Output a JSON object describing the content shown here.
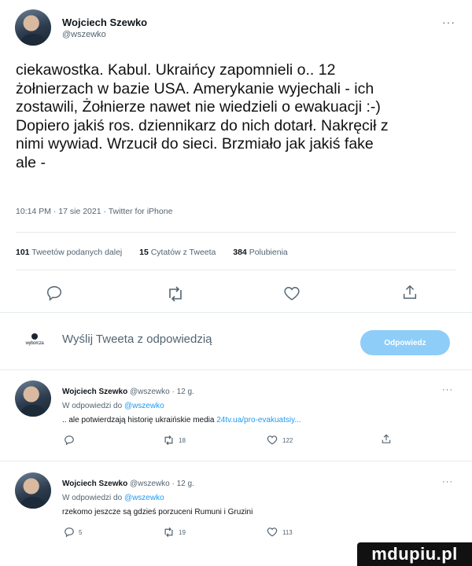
{
  "main_tweet": {
    "author_name": "Wojciech Szewko",
    "author_handle": "@wszewko",
    "more": "···",
    "text": "ciekawostka. Kabul. Ukraińcy zapomnieli o.. 12\nżołnierzach w bazie USA. Amerykanie wyjechali - ich\nzostawili, Żołnierze nawet nie wiedzieli o ewakuacji :-)\nDopiero jakiś ros. dziennikarz do nich dotarł. Nakręcił z\nnimi wywiad. Wrzucił do sieci. Brzmiało jak jakiś fake\nale -",
    "meta": "10:14 PM · 17 sie 2021 · Twitter for iPhone",
    "stats": {
      "retweets_count": "101",
      "retweets_label": "Tweetów podanych dalej",
      "quotes_count": "15",
      "quotes_label": "Cytatów z Tweeta",
      "likes_count": "384",
      "likes_label": "Polubienia"
    },
    "action_icons": [
      "reply-icon",
      "retweet-icon",
      "like-icon",
      "share-icon"
    ]
  },
  "reply_bar": {
    "avatar_label": "wyborcza",
    "placeholder": "Wyślij Tweeta z odpowiedzią",
    "button_label": "Odpowiedz"
  },
  "replies": [
    {
      "author_name": "Wojciech Szewko",
      "handle_time": "@wszewko · 12 g.",
      "more": "···",
      "replying_prefix": "W odpowiedzi do",
      "replying_handle": "@wszewko",
      "text": ".. ale potwierdzają historię ukraińskie media",
      "link": "24tv.ua/pro-evakuatsiy...",
      "reply_count": "",
      "retweet_count": "18",
      "like_count": "122"
    },
    {
      "author_name": "Wojciech Szewko",
      "handle_time": "@wszewko · 12 g.",
      "more": "···",
      "replying_prefix": "W odpowiedzi do",
      "replying_handle": "@wszewko",
      "text": "rzekomo jeszcze są gdzieś porzuceni Rumuni i Gruzini",
      "link": "",
      "reply_count": "5",
      "retweet_count": "19",
      "like_count": "113"
    }
  ],
  "watermark": "mdupiu.pl",
  "colors": {
    "accent": "#1d9bf0",
    "reply_button": "#8ecdf8",
    "muted": "#536471"
  }
}
